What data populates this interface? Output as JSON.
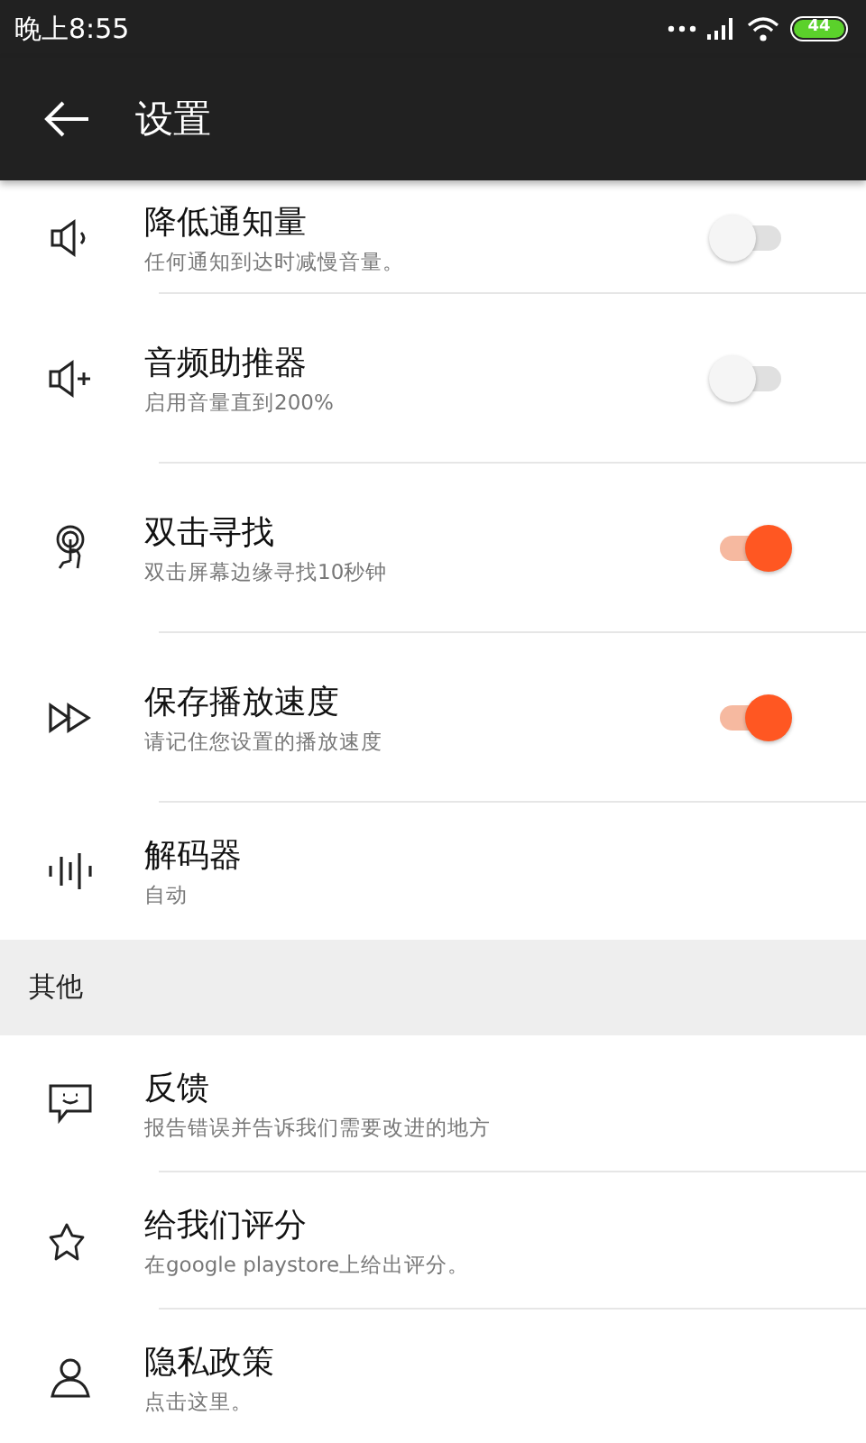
{
  "status_bar": {
    "time": "晚上8:55",
    "battery": "44"
  },
  "app_bar": {
    "title": "设置"
  },
  "sections": [
    {
      "items": [
        {
          "kind": "toggle",
          "title": "降低通知量",
          "subtitle": "任何通知到达时减慢音量。",
          "on": false
        },
        {
          "kind": "toggle",
          "title": "音频助推器",
          "subtitle": "启用音量直到200%",
          "on": false
        },
        {
          "kind": "toggle",
          "title": "双击寻找",
          "subtitle": "双击屏幕边缘寻找10秒钟",
          "on": true
        },
        {
          "kind": "toggle",
          "title": "保存播放速度",
          "subtitle": "请记住您设置的播放速度",
          "on": true
        },
        {
          "kind": "plain",
          "title": "解码器",
          "subtitle": "自动"
        }
      ]
    },
    {
      "header": "其他",
      "items": [
        {
          "kind": "plain",
          "title": "反馈",
          "subtitle": "报告错误并告诉我们需要改进的地方"
        },
        {
          "kind": "plain",
          "title": "给我们评分",
          "subtitle": "在google playstore上给出评分。"
        },
        {
          "kind": "plain",
          "title": "隐私政策",
          "subtitle": "点击这里。"
        }
      ]
    }
  ]
}
